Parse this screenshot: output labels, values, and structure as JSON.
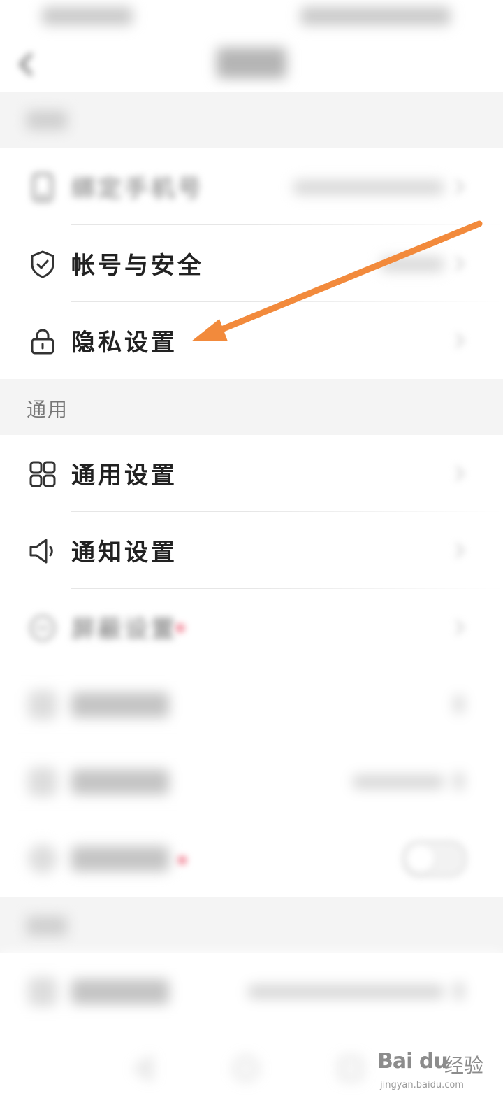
{
  "sections": {
    "general_header": "通用"
  },
  "rows": {
    "bind_phone": "绑定手机号",
    "account_security": "帐号与安全",
    "privacy_settings": "隐私设置",
    "general_settings": "通用设置",
    "notification_settings": "通知设置",
    "block_settings": "屏蔽设置"
  },
  "watermark": {
    "logo": "Bai du",
    "brand": "经验",
    "url": "jingyan.baidu.com"
  },
  "colors": {
    "arrow": "#f28a3c",
    "section_bg": "#f4f4f4",
    "badge_red": "#f07a8d"
  },
  "icons": {
    "back": "chevron-left-icon",
    "phone": "phone-icon",
    "shield": "shield-check-icon",
    "lock": "lock-icon",
    "grid": "grid-icon",
    "speaker": "speaker-icon",
    "block": "minus-circle-icon"
  }
}
